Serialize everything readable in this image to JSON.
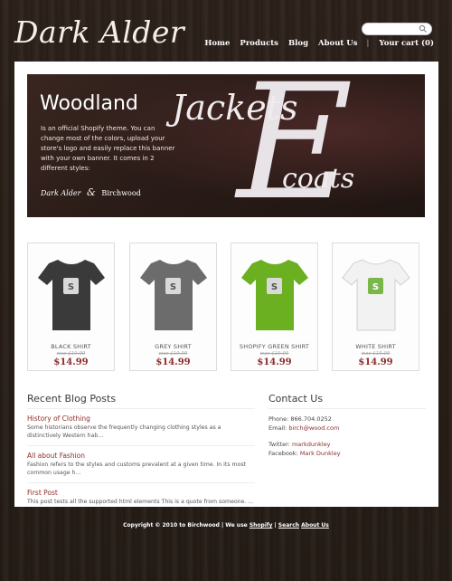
{
  "header": {
    "logo": "Dark Alder",
    "search": {
      "placeholder": ""
    },
    "nav": [
      {
        "label": "Home"
      },
      {
        "label": "Products"
      },
      {
        "label": "Blog"
      },
      {
        "label": "About Us"
      }
    ],
    "cart": "Your cart (0)"
  },
  "banner": {
    "title": "Woodland",
    "text": "Is an official Shopify theme. You can change most of the colors, upload your store's logo and easily replace this banner with your own banner. It comes in 2 different styles:",
    "brand_left": "Dark Alder",
    "brand_amp": "&",
    "brand_right": "Birchwood",
    "big_e": "E",
    "jackets": "Jackets",
    "coats": "coats"
  },
  "products": [
    {
      "name": "BLACK SHIRT",
      "was": "was $19.99",
      "price": "$14.99",
      "color": "#3a3a3a"
    },
    {
      "name": "GREY SHIRT",
      "was": "was $19.99",
      "price": "$14.99",
      "color": "#6c6c6c"
    },
    {
      "name": "SHOPIFY GREEN SHIRT",
      "was": "was $19.99",
      "price": "$14.99",
      "color": "#6bb021"
    },
    {
      "name": "WHITE SHIRT",
      "was": "was $19.99",
      "price": "$14.99",
      "color": "#f2f2f2"
    }
  ],
  "blog": {
    "title": "Recent Blog Posts",
    "posts": [
      {
        "title": "History of Clothing",
        "excerpt": "Some historians observe the frequently changing clothing styles as a distinctively Western hab..."
      },
      {
        "title": "All about Fashion",
        "excerpt": "Fashion refers to the styles and customs prevalent at a given time. In its most common usage h..."
      },
      {
        "title": "First Post",
        "excerpt": "This post tests all the supported html elements This is a quote from someone. ..."
      }
    ]
  },
  "contact": {
    "title": "Contact Us",
    "phone_label": "Phone:",
    "phone": "866.704.0252",
    "email_label": "Email:",
    "email": "birch@wood.com",
    "twitter_label": "Twitter:",
    "twitter": "markdunkley",
    "facebook_label": "Facebook:",
    "facebook": "Mark Dunkley"
  },
  "footer": {
    "copyright": "Copyright © 2010 to Birchwood | We use",
    "shopify": "Shopify",
    "sep": "|",
    "search": "Search",
    "about": "About Us"
  },
  "colors": {
    "accent": "#8c2d2a",
    "background": "#2a2019"
  }
}
